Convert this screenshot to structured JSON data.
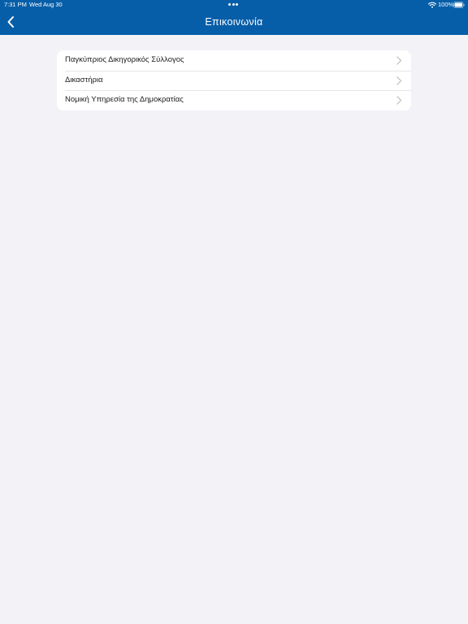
{
  "status_bar": {
    "time": "7:31 PM",
    "date": "Wed Aug 30",
    "battery": "100%"
  },
  "nav": {
    "title": "Επικοινωνία",
    "back_icon": "chevron-left-icon"
  },
  "list": {
    "items": [
      {
        "label": "Παγκύπριος Δικηγορικός Σύλλογος"
      },
      {
        "label": "Δικαστήρια"
      },
      {
        "label": "Νομική Υπηρεσία της Δημοκρατίας"
      }
    ],
    "row_icon": "chevron-right-icon"
  },
  "colors": {
    "header_bg": "#075ea8",
    "page_bg": "#f2f2f7",
    "card_bg": "#ffffff",
    "chevron": "#c4c4c7"
  }
}
